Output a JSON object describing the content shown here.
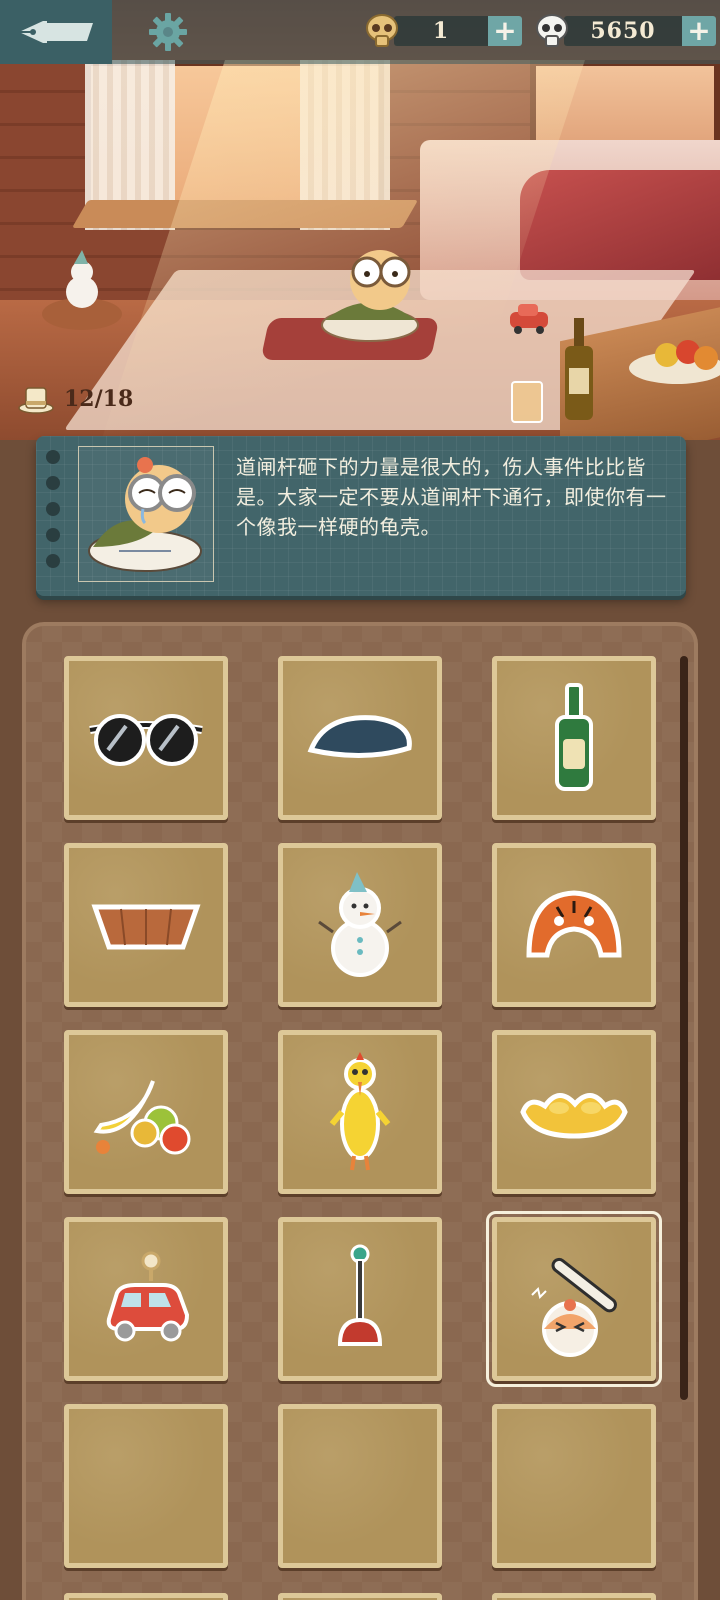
{
  "topbar": {
    "currencies": [
      {
        "name": "skull-coin",
        "amount": "1"
      },
      {
        "name": "panda-coin",
        "amount": "5650"
      }
    ],
    "plus_label": "+"
  },
  "scene": {
    "hats_collected": "12/18"
  },
  "dialog": {
    "text": "道闸杆砸下的力量是很大的，伤人事件比比皆是。大家一定不要从道闸杆下通行，即使你有一个像我一样硬的龟壳。"
  },
  "inventory": {
    "items": [
      {
        "icon": "sunglasses-icon",
        "selected": false
      },
      {
        "icon": "beret-icon",
        "selected": false
      },
      {
        "icon": "bottle-icon",
        "selected": false
      },
      {
        "icon": "basket-icon",
        "selected": false
      },
      {
        "icon": "snowman-icon",
        "selected": false
      },
      {
        "icon": "tiger-hat-icon",
        "selected": false
      },
      {
        "icon": "fruit-icon",
        "selected": false
      },
      {
        "icon": "rubber-chicken-icon",
        "selected": false
      },
      {
        "icon": "gold-ingot-icon",
        "selected": false
      },
      {
        "icon": "toy-car-icon",
        "selected": false
      },
      {
        "icon": "plunger-icon",
        "selected": false
      },
      {
        "icon": "barrier-bird-icon",
        "selected": true
      },
      {
        "icon": "empty",
        "selected": false
      },
      {
        "icon": "empty",
        "selected": false
      },
      {
        "icon": "empty",
        "selected": false
      }
    ]
  },
  "colors": {
    "topbar": "#3b6065",
    "plus_button": "#6fa6a6",
    "dialog_bg": "#42656a",
    "board_bg": "#8a6850",
    "slot_bg": "#b0935b",
    "slot_border": "#ddc898"
  }
}
